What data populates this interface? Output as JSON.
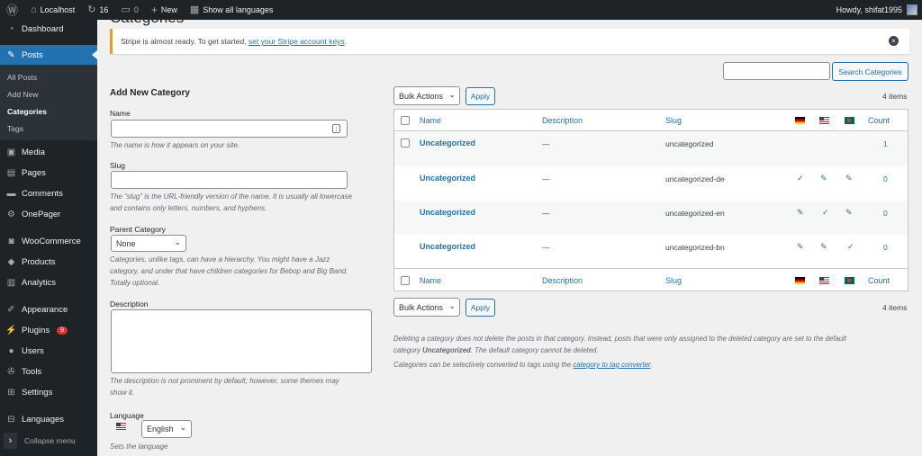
{
  "adminbar": {
    "site_name": "Localhost",
    "updates_count": "16",
    "comments_count": "0",
    "new_label": "New",
    "languages_label": "Show all languages",
    "howdy": "Howdy, shifat1995"
  },
  "sidebar": {
    "dashboard": "Dashboard",
    "posts": "Posts",
    "submenu": [
      "All Posts",
      "Add New",
      "Categories",
      "Tags"
    ],
    "media": "Media",
    "pages": "Pages",
    "comments": "Comments",
    "onepager": "OnePager",
    "woocommerce": "WooCommerce",
    "products": "Products",
    "analytics": "Analytics",
    "appearance": "Appearance",
    "plugins": "Plugins",
    "plugins_badge": "9",
    "users": "Users",
    "tools": "Tools",
    "settings": "Settings",
    "languages": "Languages",
    "collapse": "Collapse menu"
  },
  "page": {
    "title": "Categories"
  },
  "notice": {
    "text": "Stripe is almost ready. To get started, ",
    "link": "set your Stripe account keys",
    "tail": "."
  },
  "search": {
    "button": "Search Categories",
    "value": ""
  },
  "form": {
    "heading": "Add New Category",
    "name_label": "Name",
    "name_value": "",
    "name_desc": "The name is how it appears on your site.",
    "slug_label": "Slug",
    "slug_value": "",
    "slug_desc_1": "The “slug” is the URL-friendly version of the name. It is usually all lowercase",
    "slug_desc_2": "and contains only letters, numbers, and hyphens.",
    "parent_label": "Parent Category",
    "parent_value": "None",
    "parent_desc_1": "Categories, unlike tags, can have a hierarchy. You might have a Jazz",
    "parent_desc_2": "category, and under that have children categories for Bebop and Big Band.",
    "parent_desc_3": "Totally optional.",
    "description_label": "Description",
    "description_value": "",
    "description_desc_1": "The description is not prominent by default; however, some themes may",
    "description_desc_2": "show it.",
    "language_label": "Language",
    "language_value": "English",
    "language_desc": "Sets the language"
  },
  "table": {
    "bulk_actions": "Bulk Actions",
    "apply": "Apply",
    "items_count": "4 items",
    "headers": {
      "name": "Name",
      "description": "Description",
      "slug": "Slug",
      "count": "Count"
    },
    "rows": [
      {
        "name": "Uncategorized",
        "description": "—",
        "slug": "uncategorized",
        "de": "",
        "us": "",
        "bd": "",
        "count": "1"
      },
      {
        "name": "Uncategorized",
        "description": "—",
        "slug": "uncategorized-de",
        "de": "check",
        "us": "pencil",
        "bd": "pencil",
        "count": "0"
      },
      {
        "name": "Uncategorized",
        "description": "—",
        "slug": "uncategorized-en",
        "de": "pencil",
        "us": "check",
        "bd": "pencil",
        "count": "0"
      },
      {
        "name": "Uncategorized",
        "description": "—",
        "slug": "uncategorized-bn",
        "de": "pencil",
        "us": "pencil",
        "bd": "check",
        "count": "0"
      }
    ]
  },
  "footer_note": {
    "line1": "Deleting a category does not delete the posts in that category. Instead, posts that were only assigned to the deleted category are set to the default",
    "line2_pre": "category ",
    "line2_bold": "Uncategorized",
    "line2_post": ". The default category cannot be deleted.",
    "line3_pre": "Categories can be selectively converted to tags using the ",
    "line3_link": "category to tag converter",
    "line3_post": "."
  },
  "colors": {
    "accent": "#2271b1",
    "sidebar": "#1d2327",
    "notice_border": "#dba617",
    "badge": "#d63638"
  }
}
